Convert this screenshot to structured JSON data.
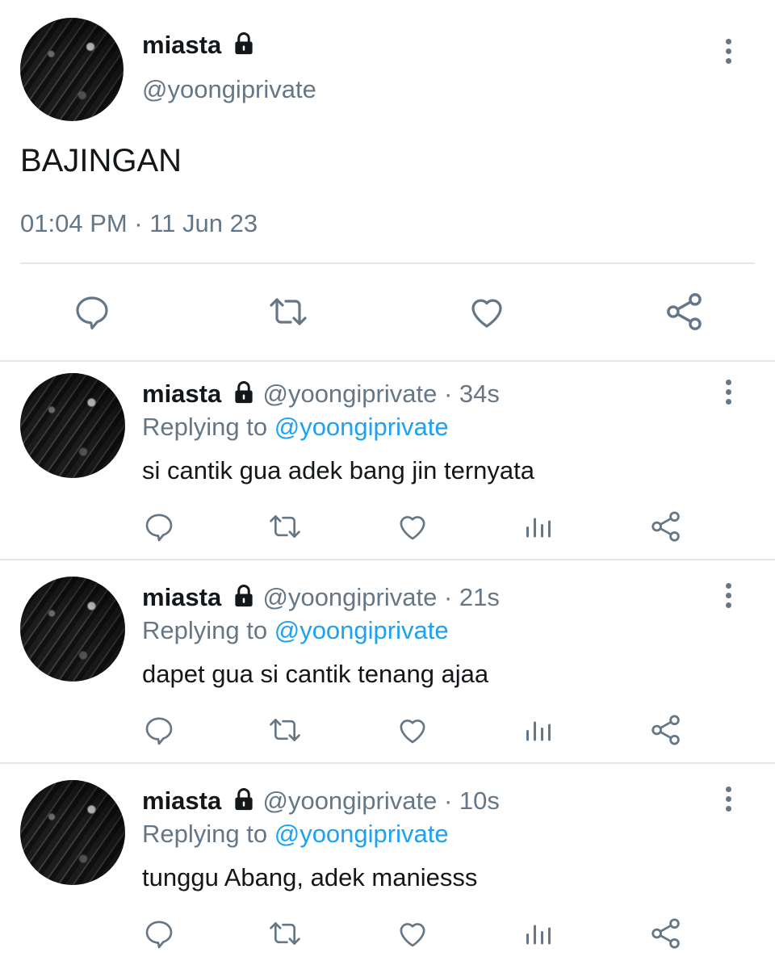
{
  "main_tweet": {
    "name": "miasta",
    "handle": "@yoongiprivate",
    "text": "BAJINGAN",
    "timestamp": "01:04 PM · 11 Jun 23"
  },
  "replies": [
    {
      "name": "miasta",
      "handle": "@yoongiprivate",
      "age": "· 34s",
      "replying_prefix": "Replying to",
      "replying_handle": "@yoongiprivate",
      "text": "si cantik gua adek bang jin ternyata"
    },
    {
      "name": "miasta",
      "handle": "@yoongiprivate",
      "age": "· 21s",
      "replying_prefix": "Replying to",
      "replying_handle": "@yoongiprivate",
      "text": "dapet gua si cantik tenang ajaa"
    },
    {
      "name": "miasta",
      "handle": "@yoongiprivate",
      "age": "· 10s",
      "replying_prefix": "Replying to",
      "replying_handle": "@yoongiprivate",
      "text": "tunggu Abang, adek maniesss"
    }
  ],
  "icons": {
    "lock": "lock-icon",
    "more": "more-vertical-icon",
    "reply": "reply-icon",
    "retweet": "retweet-icon",
    "like": "heart-icon",
    "analytics": "analytics-icon",
    "share": "share-icon"
  },
  "colors": {
    "text": "#14171a",
    "muted": "#657786",
    "link": "#1da1f2",
    "divider": "#e1e8ed"
  }
}
